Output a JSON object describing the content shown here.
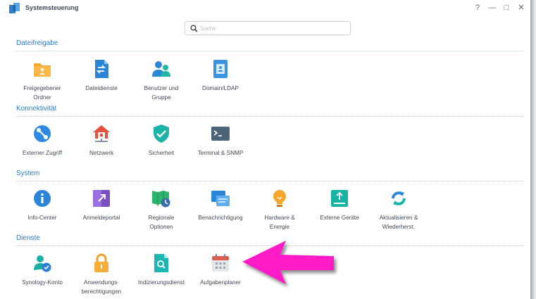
{
  "window": {
    "title": "Systemsteuerung",
    "help_label": "?",
    "minimize_label": "—",
    "maximize_label": "□",
    "close_label": "✕"
  },
  "search": {
    "placeholder": "Suche",
    "value": ""
  },
  "sections": [
    {
      "title": "Dateifreigabe",
      "items": [
        {
          "label": "Freigegebener\nOrdner",
          "icon": "shared-folder-icon"
        },
        {
          "label": "Dateidienste",
          "icon": "file-services-icon"
        },
        {
          "label": "Benutzer und\nGruppe",
          "icon": "user-group-icon"
        },
        {
          "label": "Domain/LDAP",
          "icon": "domain-ldap-icon"
        }
      ]
    },
    {
      "title": "Konnektivität",
      "items": [
        {
          "label": "Externer Zugriff",
          "icon": "external-access-icon"
        },
        {
          "label": "Netzwerk",
          "icon": "network-icon"
        },
        {
          "label": "Sicherheit",
          "icon": "security-shield-icon"
        },
        {
          "label": "Terminal & SNMP",
          "icon": "terminal-icon"
        }
      ]
    },
    {
      "title": "System",
      "items": [
        {
          "label": "Info-Center",
          "icon": "info-icon"
        },
        {
          "label": "Anmeldeportal",
          "icon": "login-portal-icon"
        },
        {
          "label": "Regionale\nOptionen",
          "icon": "regional-options-icon"
        },
        {
          "label": "Benachrichtigung",
          "icon": "notification-icon"
        },
        {
          "label": "Hardware &\nEnergie",
          "icon": "hardware-power-icon"
        },
        {
          "label": "Externe Geräte",
          "icon": "external-devices-icon"
        },
        {
          "label": "Aktualisieren &\nWiederherst.",
          "icon": "update-restore-icon"
        }
      ]
    },
    {
      "title": "Dienste",
      "items": [
        {
          "label": "Synology-Konto",
          "icon": "synology-account-icon"
        },
        {
          "label": "Anwendungs-\nberechtigungen",
          "icon": "app-privileges-icon"
        },
        {
          "label": "Indizierungsdienst",
          "icon": "indexing-service-icon"
        },
        {
          "label": "Aufgabenplaner",
          "icon": "task-scheduler-icon"
        }
      ]
    }
  ],
  "colors": {
    "section_title": "#2d7cc1",
    "annotation_arrow": "#ff1ec8"
  }
}
